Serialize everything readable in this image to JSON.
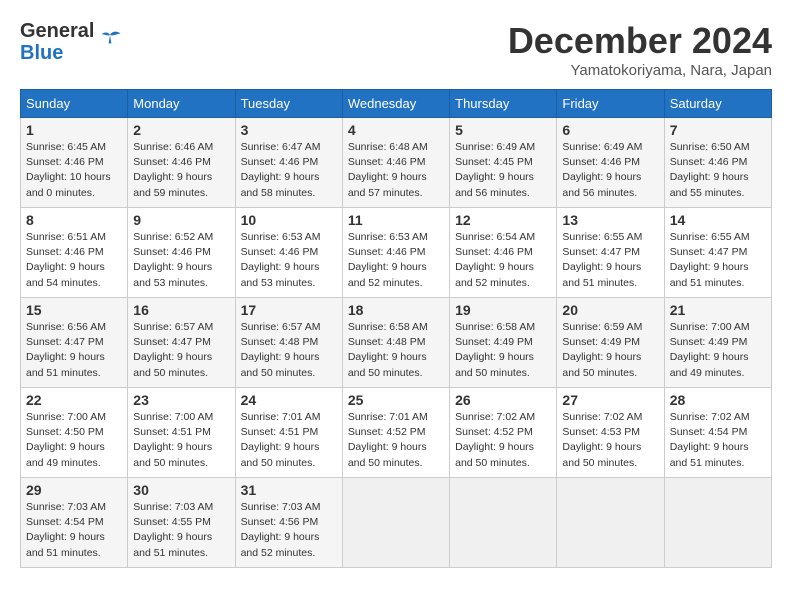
{
  "header": {
    "logo_line1": "General",
    "logo_line2": "Blue",
    "month": "December 2024",
    "location": "Yamatokoriyama, Nara, Japan"
  },
  "weekdays": [
    "Sunday",
    "Monday",
    "Tuesday",
    "Wednesday",
    "Thursday",
    "Friday",
    "Saturday"
  ],
  "weeks": [
    [
      {
        "day": "1",
        "sunrise": "6:45 AM",
        "sunset": "4:46 PM",
        "daylight": "10 hours and 0 minutes."
      },
      {
        "day": "2",
        "sunrise": "6:46 AM",
        "sunset": "4:46 PM",
        "daylight": "9 hours and 59 minutes."
      },
      {
        "day": "3",
        "sunrise": "6:47 AM",
        "sunset": "4:46 PM",
        "daylight": "9 hours and 58 minutes."
      },
      {
        "day": "4",
        "sunrise": "6:48 AM",
        "sunset": "4:46 PM",
        "daylight": "9 hours and 57 minutes."
      },
      {
        "day": "5",
        "sunrise": "6:49 AM",
        "sunset": "4:45 PM",
        "daylight": "9 hours and 56 minutes."
      },
      {
        "day": "6",
        "sunrise": "6:49 AM",
        "sunset": "4:46 PM",
        "daylight": "9 hours and 56 minutes."
      },
      {
        "day": "7",
        "sunrise": "6:50 AM",
        "sunset": "4:46 PM",
        "daylight": "9 hours and 55 minutes."
      }
    ],
    [
      {
        "day": "8",
        "sunrise": "6:51 AM",
        "sunset": "4:46 PM",
        "daylight": "9 hours and 54 minutes."
      },
      {
        "day": "9",
        "sunrise": "6:52 AM",
        "sunset": "4:46 PM",
        "daylight": "9 hours and 53 minutes."
      },
      {
        "day": "10",
        "sunrise": "6:53 AM",
        "sunset": "4:46 PM",
        "daylight": "9 hours and 53 minutes."
      },
      {
        "day": "11",
        "sunrise": "6:53 AM",
        "sunset": "4:46 PM",
        "daylight": "9 hours and 52 minutes."
      },
      {
        "day": "12",
        "sunrise": "6:54 AM",
        "sunset": "4:46 PM",
        "daylight": "9 hours and 52 minutes."
      },
      {
        "day": "13",
        "sunrise": "6:55 AM",
        "sunset": "4:47 PM",
        "daylight": "9 hours and 51 minutes."
      },
      {
        "day": "14",
        "sunrise": "6:55 AM",
        "sunset": "4:47 PM",
        "daylight": "9 hours and 51 minutes."
      }
    ],
    [
      {
        "day": "15",
        "sunrise": "6:56 AM",
        "sunset": "4:47 PM",
        "daylight": "9 hours and 51 minutes."
      },
      {
        "day": "16",
        "sunrise": "6:57 AM",
        "sunset": "4:47 PM",
        "daylight": "9 hours and 50 minutes."
      },
      {
        "day": "17",
        "sunrise": "6:57 AM",
        "sunset": "4:48 PM",
        "daylight": "9 hours and 50 minutes."
      },
      {
        "day": "18",
        "sunrise": "6:58 AM",
        "sunset": "4:48 PM",
        "daylight": "9 hours and 50 minutes."
      },
      {
        "day": "19",
        "sunrise": "6:58 AM",
        "sunset": "4:49 PM",
        "daylight": "9 hours and 50 minutes."
      },
      {
        "day": "20",
        "sunrise": "6:59 AM",
        "sunset": "4:49 PM",
        "daylight": "9 hours and 50 minutes."
      },
      {
        "day": "21",
        "sunrise": "7:00 AM",
        "sunset": "4:49 PM",
        "daylight": "9 hours and 49 minutes."
      }
    ],
    [
      {
        "day": "22",
        "sunrise": "7:00 AM",
        "sunset": "4:50 PM",
        "daylight": "9 hours and 49 minutes."
      },
      {
        "day": "23",
        "sunrise": "7:00 AM",
        "sunset": "4:51 PM",
        "daylight": "9 hours and 50 minutes."
      },
      {
        "day": "24",
        "sunrise": "7:01 AM",
        "sunset": "4:51 PM",
        "daylight": "9 hours and 50 minutes."
      },
      {
        "day": "25",
        "sunrise": "7:01 AM",
        "sunset": "4:52 PM",
        "daylight": "9 hours and 50 minutes."
      },
      {
        "day": "26",
        "sunrise": "7:02 AM",
        "sunset": "4:52 PM",
        "daylight": "9 hours and 50 minutes."
      },
      {
        "day": "27",
        "sunrise": "7:02 AM",
        "sunset": "4:53 PM",
        "daylight": "9 hours and 50 minutes."
      },
      {
        "day": "28",
        "sunrise": "7:02 AM",
        "sunset": "4:54 PM",
        "daylight": "9 hours and 51 minutes."
      }
    ],
    [
      {
        "day": "29",
        "sunrise": "7:03 AM",
        "sunset": "4:54 PM",
        "daylight": "9 hours and 51 minutes."
      },
      {
        "day": "30",
        "sunrise": "7:03 AM",
        "sunset": "4:55 PM",
        "daylight": "9 hours and 51 minutes."
      },
      {
        "day": "31",
        "sunrise": "7:03 AM",
        "sunset": "4:56 PM",
        "daylight": "9 hours and 52 minutes."
      },
      null,
      null,
      null,
      null
    ]
  ]
}
